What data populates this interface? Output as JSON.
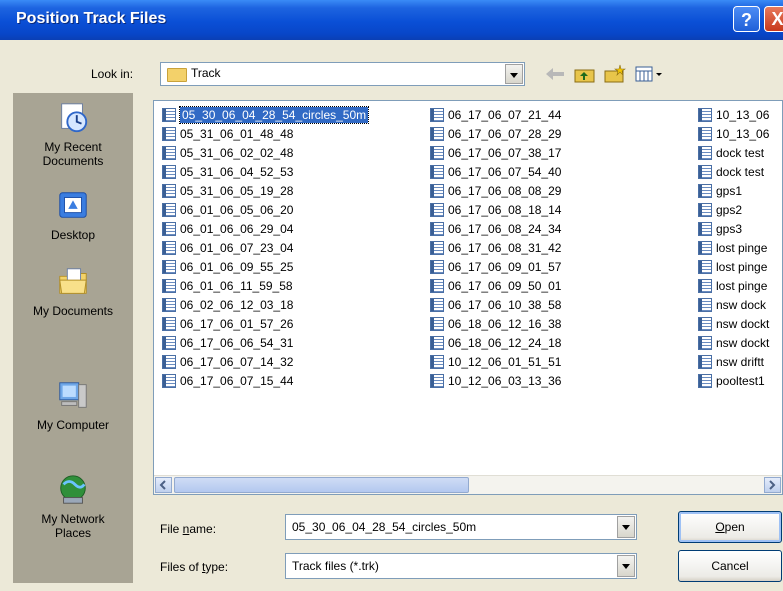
{
  "dialog": {
    "title": "Position Track Files",
    "help_label": "?",
    "close_label": "X"
  },
  "look_in": {
    "label": "Look in:",
    "value": "Track"
  },
  "places": [
    {
      "label": "My Recent Documents",
      "icon": "recent-documents-icon"
    },
    {
      "label": "Desktop",
      "icon": "desktop-icon"
    },
    {
      "label": "My Documents",
      "icon": "my-documents-icon"
    },
    {
      "label": "My Computer",
      "icon": "my-computer-icon"
    },
    {
      "label": "My Network Places",
      "icon": "network-places-icon"
    }
  ],
  "files": {
    "col1": [
      "05_30_06_04_28_54_circles_50m",
      "05_31_06_01_48_48",
      "05_31_06_02_02_48",
      "05_31_06_04_52_53",
      "05_31_06_05_19_28",
      "06_01_06_05_06_20",
      "06_01_06_06_29_04",
      "06_01_06_07_23_04",
      "06_01_06_09_55_25",
      "06_01_06_11_59_58",
      "06_02_06_12_03_18",
      "06_17_06_01_57_26",
      "06_17_06_06_54_31",
      "06_17_06_07_14_32",
      "06_17_06_07_15_44"
    ],
    "col2": [
      "06_17_06_07_21_44",
      "06_17_06_07_28_29",
      "06_17_06_07_38_17",
      "06_17_06_07_54_40",
      "06_17_06_08_08_29",
      "06_17_06_08_18_14",
      "06_17_06_08_24_34",
      "06_17_06_08_31_42",
      "06_17_06_09_01_57",
      "06_17_06_09_50_01",
      "06_17_06_10_38_58",
      "06_18_06_12_16_38",
      "06_18_06_12_24_18",
      "10_12_06_01_51_51",
      "10_12_06_03_13_36"
    ],
    "col3": [
      "10_13_06",
      "10_13_06",
      "dock test",
      "dock test",
      "gps1",
      "gps2",
      "gps3",
      "lost pinge",
      "lost pinge",
      "lost pinge",
      "nsw dock",
      "nsw dockt",
      "nsw dockt",
      "nsw driftt",
      "pooltest1"
    ]
  },
  "file_name": {
    "label_pre": "File ",
    "label_ul": "n",
    "label_post": "ame:",
    "value": "05_30_06_04_28_54_circles_50m"
  },
  "file_type": {
    "label_pre": "Files of ",
    "label_ul": "t",
    "label_post": "ype:",
    "value": "Track files (*.trk)"
  },
  "buttons": {
    "open_ul": "O",
    "open_rest": "pen",
    "cancel": "Cancel"
  },
  "colors": {
    "titlebar": "#0a4fd6",
    "selection": "#316ac5",
    "dialog_bg": "#ece9d8"
  }
}
